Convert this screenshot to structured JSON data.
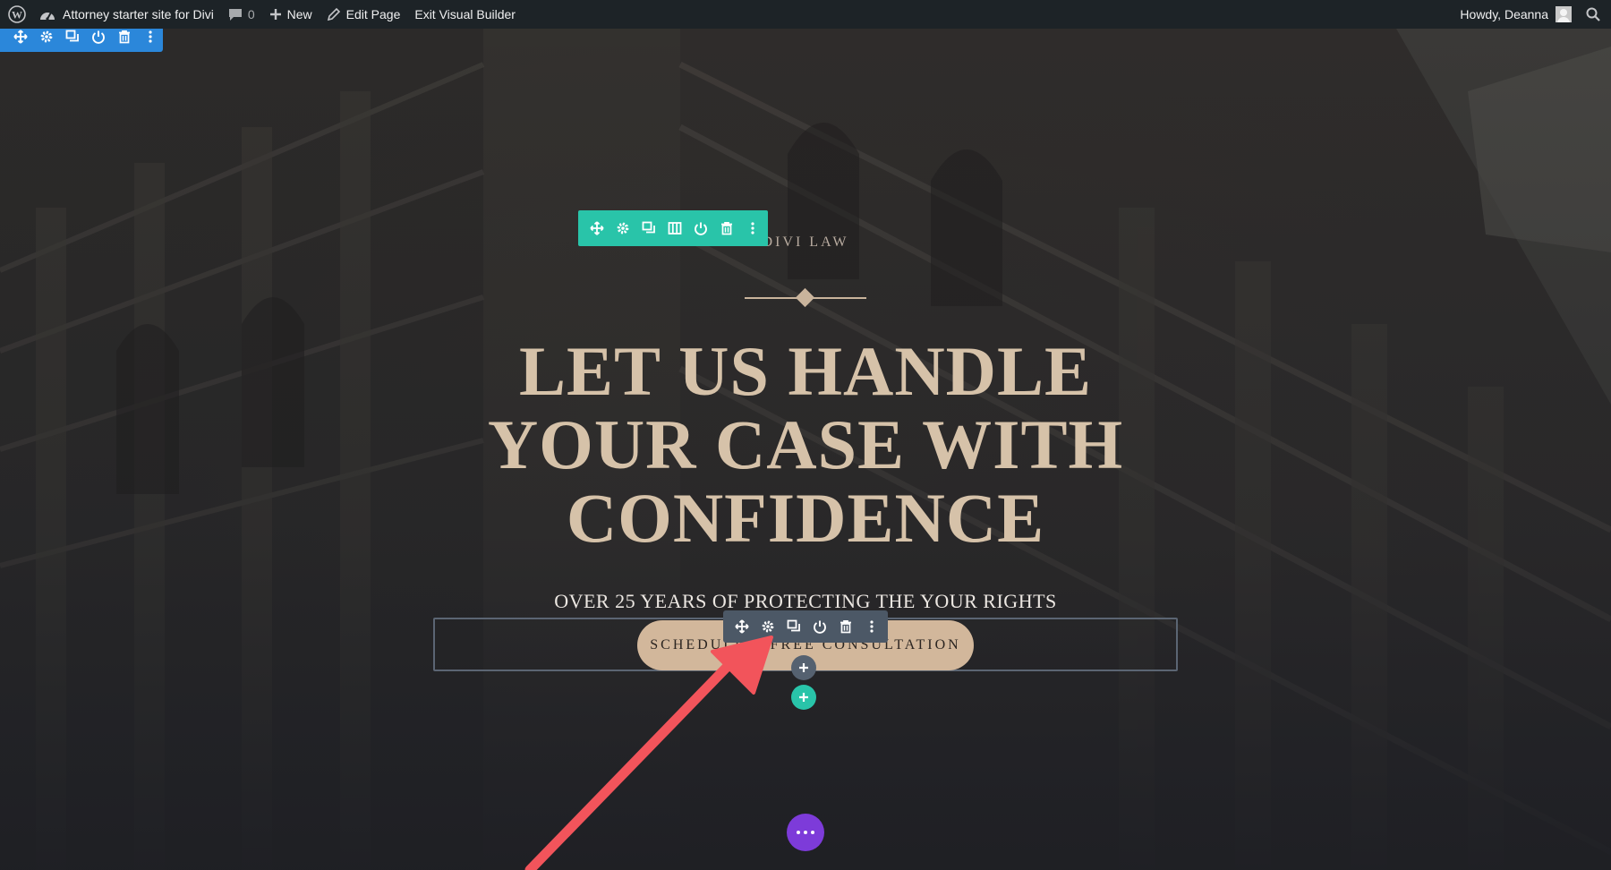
{
  "admin_bar": {
    "site_name": "Attorney starter site for Divi",
    "comments_count": "0",
    "new_label": "New",
    "edit_page_label": "Edit Page",
    "exit_builder_label": "Exit Visual Builder",
    "greeting": "Howdy, Deanna"
  },
  "hero": {
    "eyebrow": "DIVI LAW",
    "headline": [
      "LET US HANDLE",
      "YOUR CASE WITH",
      "CONFIDENCE"
    ],
    "subheadline": "OVER 25 YEARS OF PROTECTING THE YOUR RIGHTS",
    "cta_label": "SCHEDULE A FREE CONSULTATION"
  },
  "toolbars": {
    "section": [
      "move-icon",
      "gear-icon",
      "duplicate-icon",
      "power-icon",
      "trash-icon",
      "more-icon"
    ],
    "row": [
      "move-icon",
      "gear-icon",
      "duplicate-icon",
      "columns-icon",
      "power-icon",
      "trash-icon",
      "more-icon"
    ],
    "module": [
      "move-icon",
      "gear-icon",
      "duplicate-icon",
      "power-icon",
      "trash-icon",
      "more-icon"
    ]
  },
  "colors": {
    "admin_bar": "#1d2327",
    "section_toolbar": "#2b87da",
    "row_toolbar": "#29c4a9",
    "module_toolbar": "#4c5866",
    "page_settings_button": "#7d3bd9",
    "headline": "#d6c2a9",
    "cta_background": "#d2b79b",
    "annotation_arrow": "#f2545b"
  }
}
